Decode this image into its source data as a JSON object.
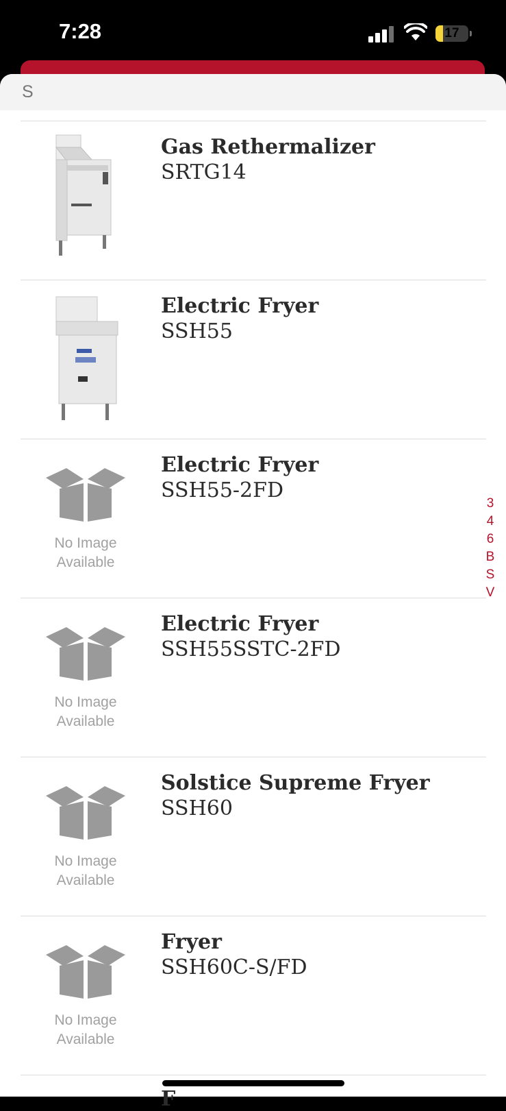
{
  "status_bar": {
    "time": "7:28",
    "battery_level": "17"
  },
  "section_header": "S",
  "index": [
    "3",
    "4",
    "6",
    "B",
    "S",
    "V"
  ],
  "no_image_text": {
    "line1": "No Image",
    "line2": "Available"
  },
  "items": [
    {
      "title": "Gas Rethermalizer",
      "model": "SRTG14",
      "image": "rethermalizer-photo"
    },
    {
      "title": "Electric Fryer",
      "model": "SSH55",
      "image": "fryer-photo"
    },
    {
      "title": "Electric Fryer",
      "model": "SSH55-2FD",
      "image": "no-image"
    },
    {
      "title": "Electric Fryer",
      "model": "SSH55SSTC-2FD",
      "image": "no-image"
    },
    {
      "title": "Solstice Supreme Fryer",
      "model": "SSH60",
      "image": "no-image"
    },
    {
      "title": "Fryer",
      "model": "SSH60C-S/FD",
      "image": "no-image"
    }
  ],
  "peek_item": {
    "title": "F"
  }
}
